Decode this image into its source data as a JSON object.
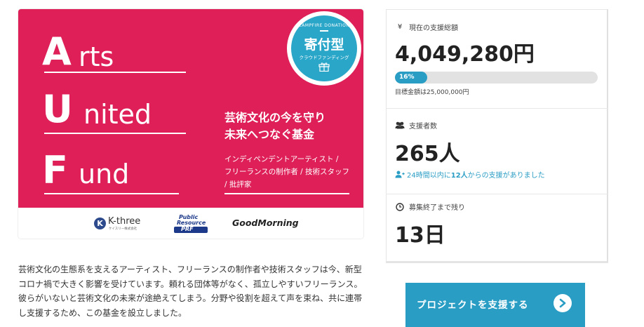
{
  "banner": {
    "logo": {
      "letters": [
        "A",
        "U",
        "F"
      ],
      "words": [
        "rts",
        "nited",
        "und"
      ]
    },
    "badge": {
      "top_text": "CAMPFIRE DONATION",
      "main": "寄付型",
      "sub": "クラウドファンディング"
    },
    "slogan": [
      "芸術文化の今を守り",
      "未来へつなぐ基金"
    ],
    "subtext": [
      "インディペンデントアーティスト /",
      "フリーランスの制作者 / 技術スタッフ",
      "/ 批評家"
    ],
    "sponsors": {
      "kthree": {
        "mark": "K",
        "name": "K-three",
        "small": "ケイスリー株式会社"
      },
      "prf": {
        "line1": "Public",
        "line2": "Resource",
        "line3": "PRF"
      },
      "goodmorning": "GoodMorning"
    }
  },
  "description": [
    "芸術文化の生態系を支えるアーティスト、フリーランスの制作者や技術スタッフは今、新型",
    "コロナ禍で大きく影響を受けています。頼れる団体等がなく、孤立しやすいフリーランス。",
    "彼らがいないと芸術文化の未来が途絶えてしまう。分野や役割を超えて声を束ね、共に連帯",
    "し支援するため、この基金を設立しました。"
  ],
  "stats": {
    "total": {
      "icon": "yen-icon",
      "icon_glyph": "¥",
      "label": "現在の支援総額",
      "value": "4,049,280円",
      "progress_label": "16%",
      "progress": 0.16,
      "target": "目標金額は25,000,000円"
    },
    "supporters": {
      "icon": "users-icon",
      "label": "支援者数",
      "value": "265人",
      "recent_prefix": "24時間以内に",
      "recent_count": "12人",
      "recent_suffix": "からの支援がありました"
    },
    "remaining": {
      "icon": "clock-icon",
      "label": "募集終了まで残り",
      "value": "13日"
    }
  },
  "cta": {
    "label": "プロジェクトを支援する"
  },
  "colors": {
    "banner": "#de1f58",
    "accent": "#2a9dc4",
    "track": "#e2e2e2"
  }
}
